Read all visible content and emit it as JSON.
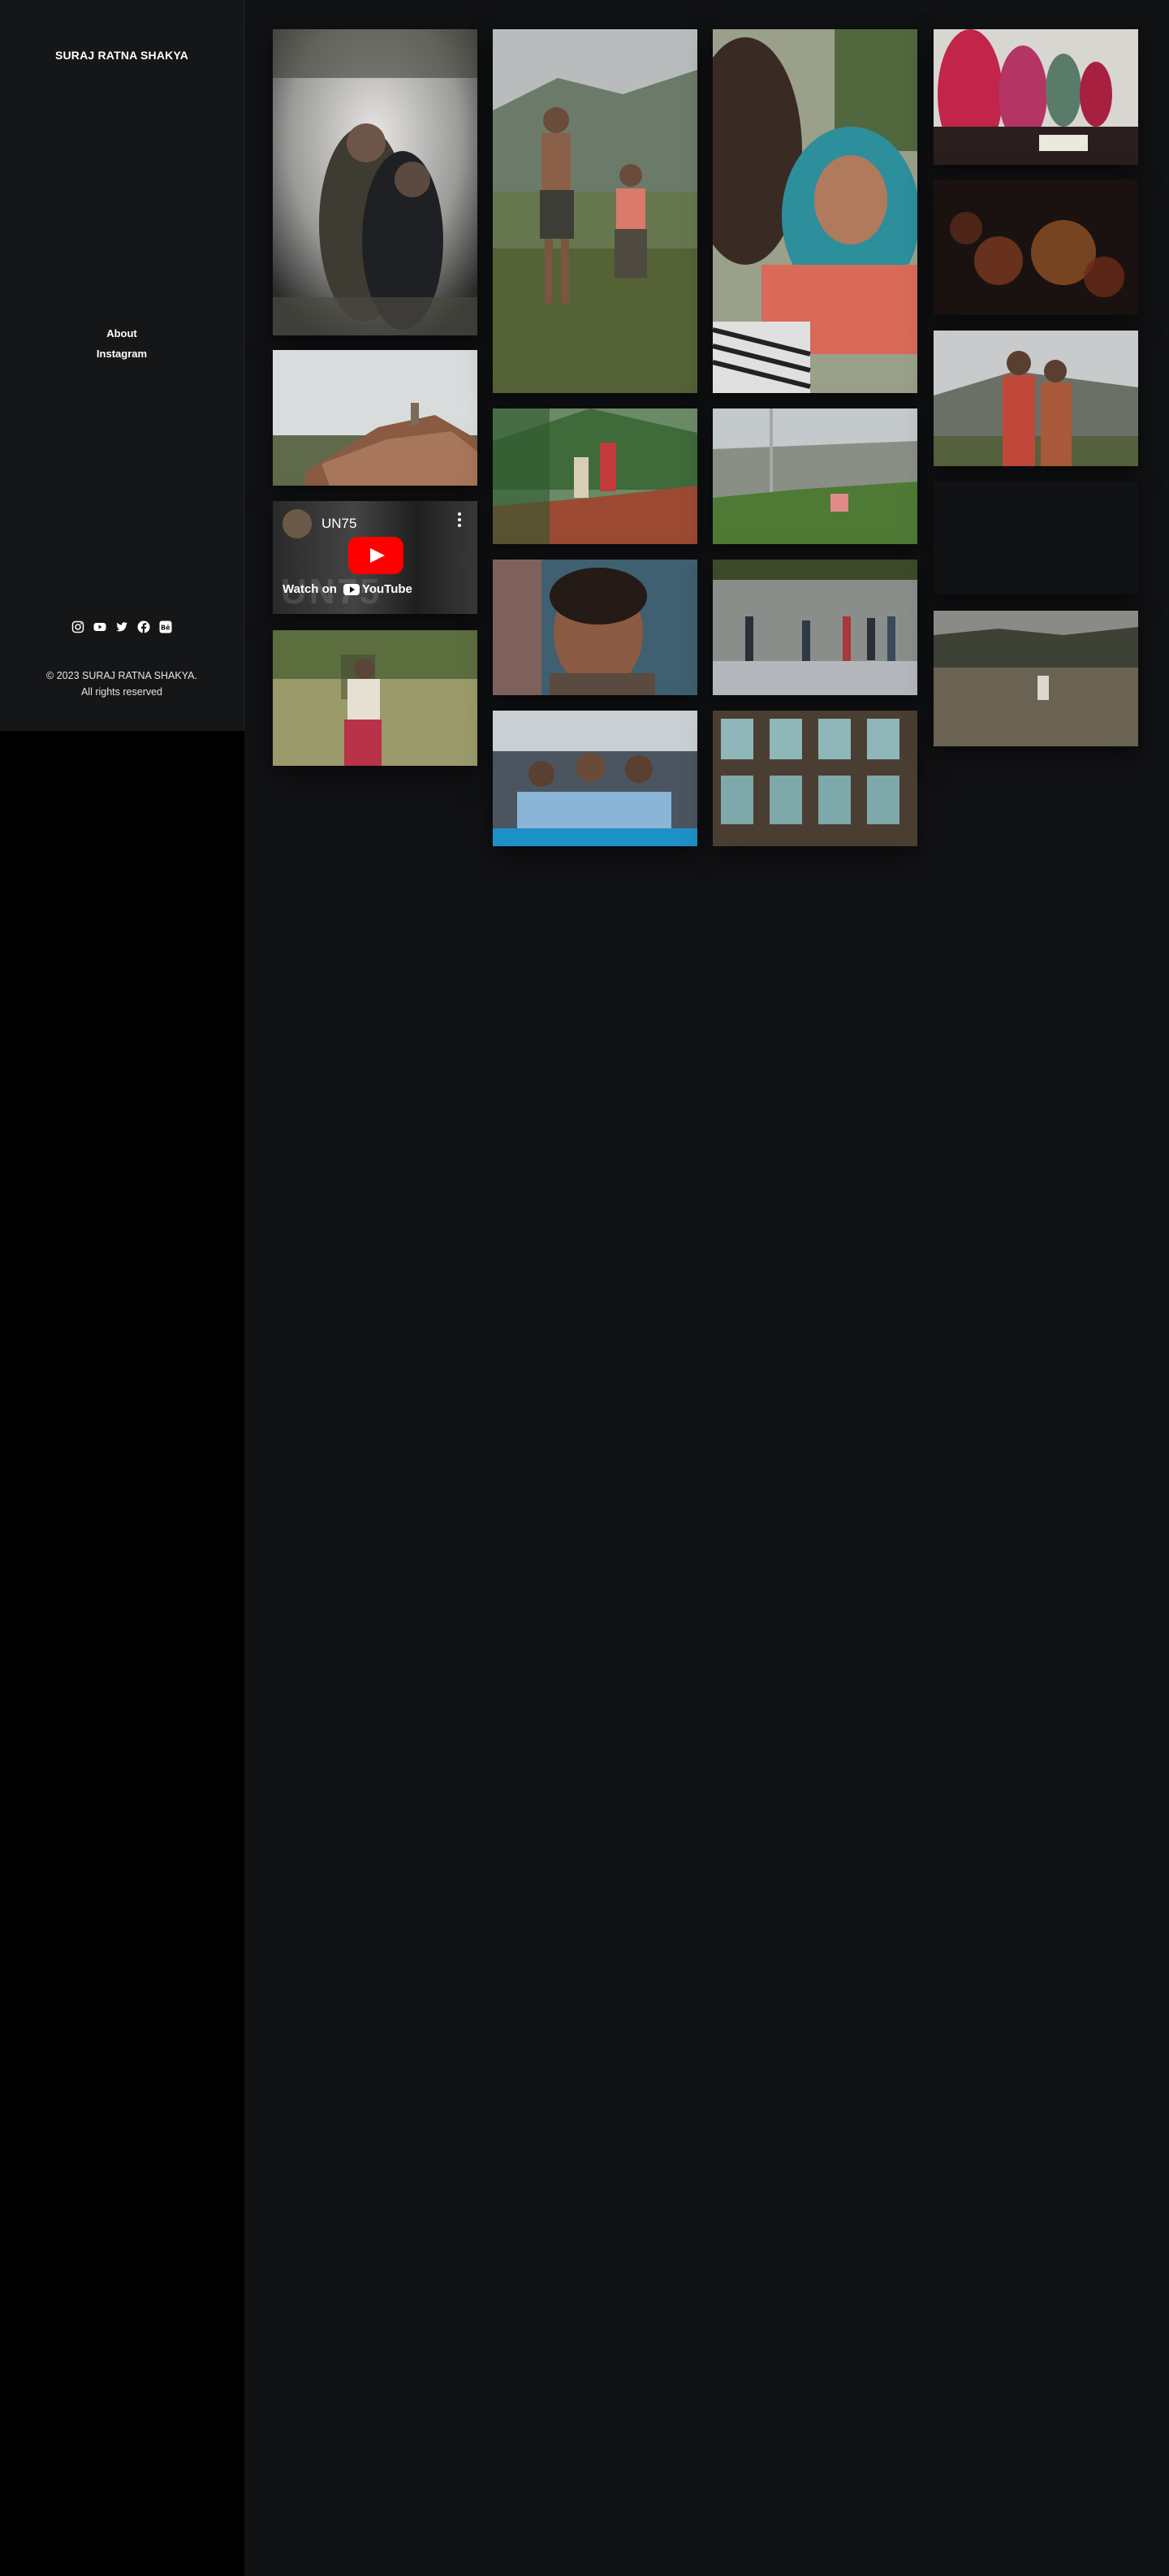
{
  "site": {
    "title": "SURAJ RATNA SHAKYA"
  },
  "nav": [
    {
      "label": "About"
    },
    {
      "label": "Instagram"
    }
  ],
  "socials": [
    {
      "icon": "instagram-icon"
    },
    {
      "icon": "youtube-icon"
    },
    {
      "icon": "twitter-icon"
    },
    {
      "icon": "facebook-icon"
    },
    {
      "icon": "behance-icon"
    }
  ],
  "footer": {
    "line1": "© 2023 SURAJ RATNA SHAKYA.",
    "line2": "All rights reserved"
  },
  "video": {
    "title": "UN75",
    "watch_label": "Watch on",
    "platform": "YouTube",
    "overlay_text": "UN75"
  },
  "colors": {
    "sidebar_bg": "#151618",
    "main_bg": "#111214",
    "youtube_red": "#ff0000"
  }
}
